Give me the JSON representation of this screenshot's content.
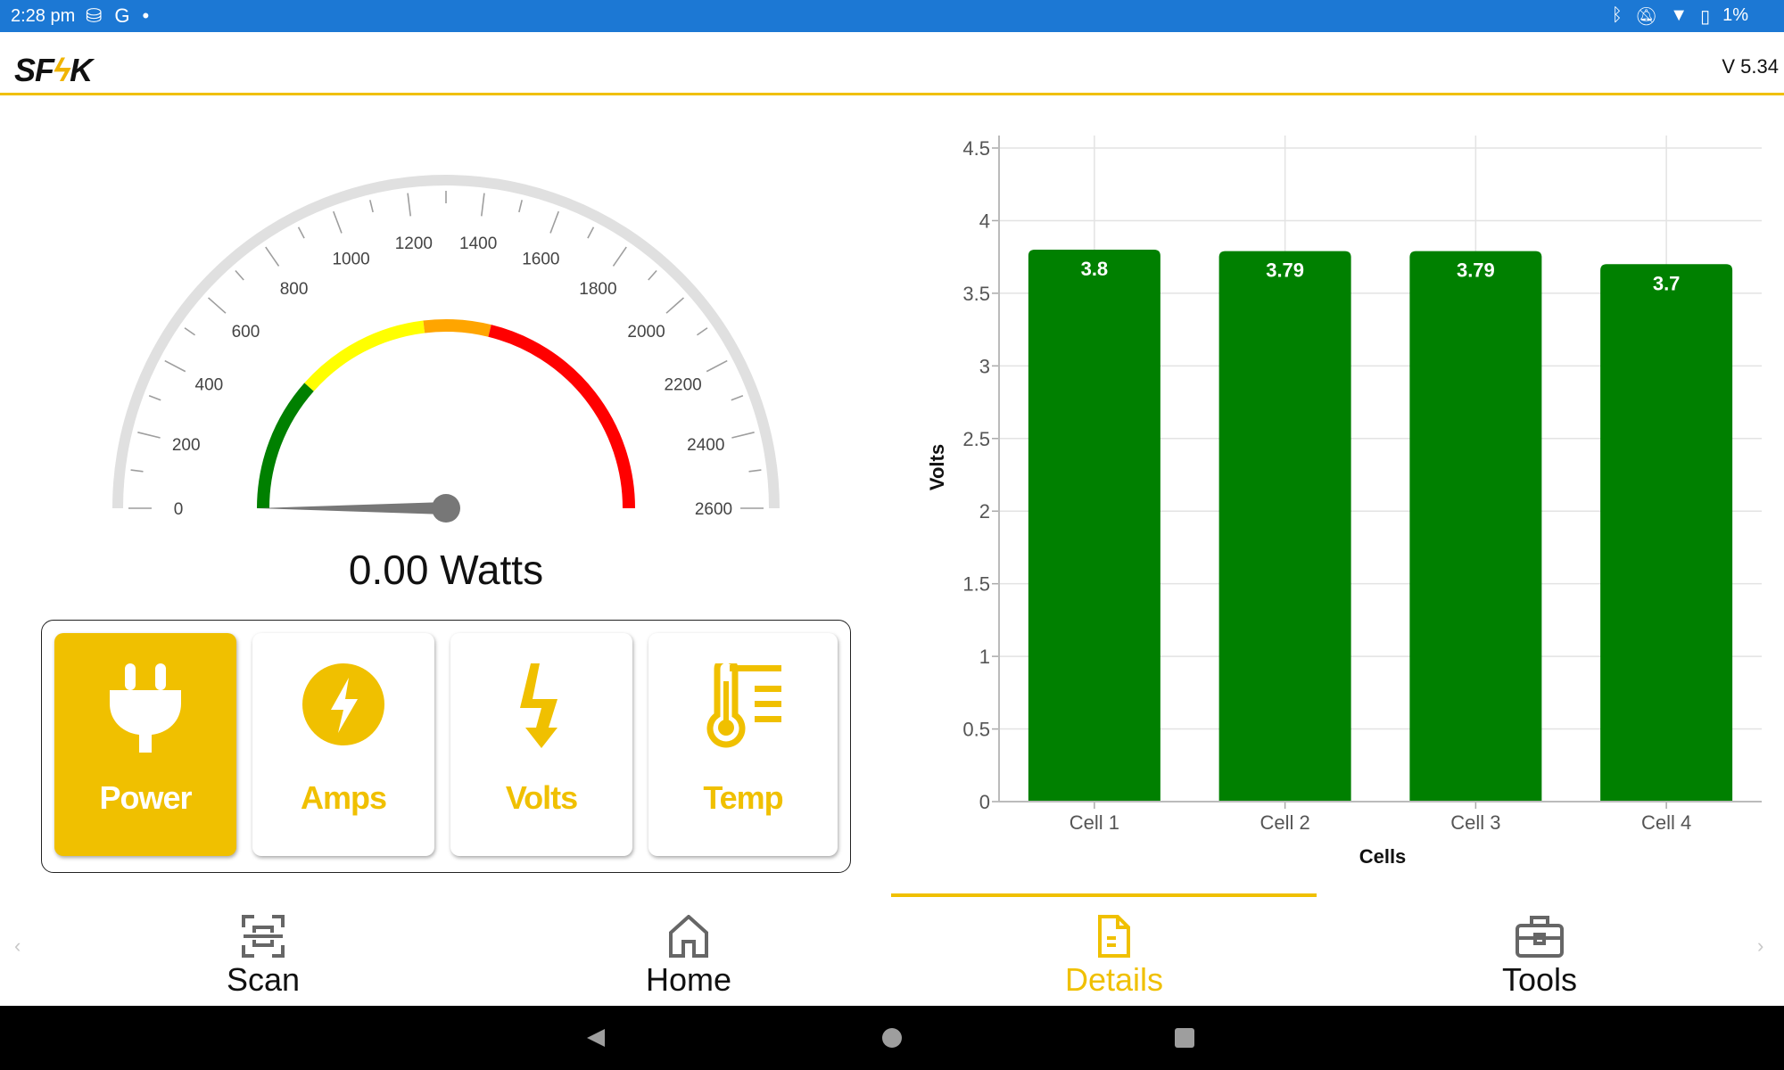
{
  "status_bar": {
    "time": "2:28 pm",
    "battery": "1%",
    "icons": [
      "sim-icon",
      "google-icon",
      "dot-icon",
      "bluetooth-icon",
      "mute-icon",
      "wifi-icon",
      "battery-icon"
    ]
  },
  "header": {
    "logo": "SFK",
    "version": "V 5.34",
    "accent": "#f0c000"
  },
  "gauge": {
    "min": 0,
    "max": 2600,
    "major_step": 200,
    "minor_step": 100,
    "value": 0,
    "labels": [
      "0",
      "200",
      "400",
      "600",
      "800",
      "1000",
      "1200",
      "1400",
      "1600",
      "1800",
      "2000",
      "2200",
      "2400",
      "2600"
    ],
    "bands": [
      {
        "from": 0,
        "to": 600,
        "color": "#008000"
      },
      {
        "from": 600,
        "to": 1200,
        "color": "#ffff00"
      },
      {
        "from": 1200,
        "to": 1500,
        "color": "#ffa500"
      },
      {
        "from": 1500,
        "to": 2600,
        "color": "#ff0000"
      }
    ],
    "readout": "0.00 Watts"
  },
  "modes": [
    {
      "label": "Power",
      "icon": "plug-icon",
      "active": true
    },
    {
      "label": "Amps",
      "icon": "bolt-circle-icon",
      "active": false
    },
    {
      "label": "Volts",
      "icon": "lightning-arrow-icon",
      "active": false
    },
    {
      "label": "Temp",
      "icon": "thermometer-icon",
      "active": false
    }
  ],
  "chart_data": {
    "type": "bar",
    "categories": [
      "Cell 1",
      "Cell 2",
      "Cell 3",
      "Cell 4"
    ],
    "values": [
      3.8,
      3.79,
      3.79,
      3.7
    ],
    "data_labels": [
      "3.8",
      "3.79",
      "3.79",
      "3.7"
    ],
    "xlabel": "Cells",
    "ylabel": "Volts",
    "ylim": [
      0,
      4.5
    ],
    "yticks": [
      "0",
      "0.5",
      "1",
      "1.5",
      "2",
      "2.5",
      "3",
      "3.5",
      "4",
      "4.5"
    ],
    "grid": true,
    "bar_color": "#008000"
  },
  "nav": {
    "items": [
      {
        "label": "Scan",
        "icon": "scan-icon"
      },
      {
        "label": "Home",
        "icon": "home-icon"
      },
      {
        "label": "Details",
        "icon": "document-icon",
        "active": true
      },
      {
        "label": "Tools",
        "icon": "toolbox-icon"
      }
    ],
    "prev": "‹",
    "next": "›"
  }
}
